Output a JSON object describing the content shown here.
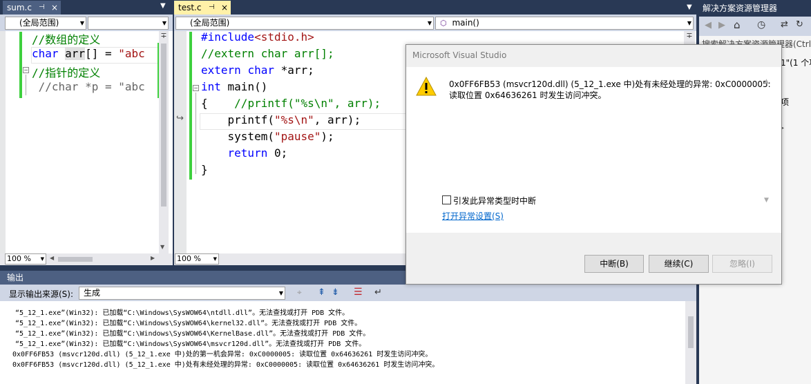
{
  "sum_tab": {
    "name": "sum.c",
    "pin": "⊣",
    "close": "×"
  },
  "test_tab": {
    "name": "test.c",
    "pin": "⊣",
    "close": "×"
  },
  "sum_nav": {
    "scope": "(全局范围)",
    "member": ""
  },
  "test_nav": {
    "scope": "(全局范围)",
    "member": "main()"
  },
  "sum_code": [
    {
      "t": "//数组的定义",
      "c": "cm"
    },
    {
      "parts": [
        [
          "char",
          "kw"
        ],
        [
          " ",
          ""
        ],
        [
          "arr",
          "hl"
        ],
        [
          "[] = ",
          ""
        ],
        [
          "\"abc",
          "st"
        ]
      ]
    },
    {
      "t": "//指针的定义",
      "c": "cm"
    },
    {
      "t": " //char *p = \"abc",
      "c": "gy"
    }
  ],
  "test_code": [
    {
      "parts": [
        [
          "#include",
          "kw"
        ],
        [
          "<stdio.h>",
          "st"
        ]
      ]
    },
    {
      "t": "//extern char arr[];",
      "c": "cm"
    },
    {
      "parts": [
        [
          "extern",
          "kw"
        ],
        [
          " ",
          ""
        ],
        [
          "char",
          "kw"
        ],
        [
          " *arr;",
          ""
        ]
      ]
    },
    {
      "parts": [
        [
          "int",
          "kw"
        ],
        [
          " main()",
          ""
        ]
      ]
    },
    {
      "parts": [
        [
          "{",
          ""
        ],
        [
          "    //printf(\"%s\\n\", arr);",
          "cm"
        ]
      ]
    },
    {
      "parts": [
        [
          "    printf(",
          ""
        ],
        [
          "\"%s\\n\"",
          "st"
        ],
        [
          ", arr);",
          ""
        ]
      ]
    },
    {
      "parts": [
        [
          "    system(",
          ""
        ],
        [
          "\"pause\"",
          "st"
        ],
        [
          ");",
          ""
        ]
      ]
    },
    {
      "parts": [
        [
          "    ",
          ""
        ],
        [
          "return",
          "kw"
        ],
        [
          " 0;",
          ""
        ]
      ]
    },
    {
      "parts": [
        [
          "}",
          ""
        ]
      ]
    }
  ],
  "zoom_left": "100 %",
  "zoom_right": "100 %",
  "solution_explorer": {
    "title": "解决方案资源管理器",
    "search": "搜索解决方案资源管理器(Ctrl",
    "item1": "1\"(1 个项",
    "item2": "项"
  },
  "output": {
    "title": "输出",
    "source_label": "显示输出来源(S):",
    "source_value": "生成",
    "lines": [
      "“5_12_1.exe”(Win32):  已加载“C:\\Windows\\SysWOW64\\ntdll.dll”。无法查找或打开 PDB 文件。",
      "“5_12_1.exe”(Win32):  已加载“C:\\Windows\\SysWOW64\\kernel32.dll”。无法查找或打开 PDB 文件。",
      "“5_12_1.exe”(Win32):  已加载“C:\\Windows\\SysWOW64\\KernelBase.dll”。无法查找或打开 PDB 文件。",
      "“5_12_1.exe”(Win32):  已加载“C:\\Windows\\SysWOW64\\msvcr120d.dll”。无法查找或打开 PDB 文件。",
      "0x0FF6FB53 (msvcr120d.dll) (5_12_1.exe 中)处的第一机会异常:  0xC0000005:  读取位置 0x64636261 时发生访问冲突。",
      "0x0FF6FB53 (msvcr120d.dll) (5_12_1.exe 中)处有未经处理的异常:  0xC0000005:  读取位置 0x64636261 时发生访问冲突。"
    ]
  },
  "dialog": {
    "title": "Microsoft Visual Studio",
    "message1": "0x0FF6FB53 (msvcr120d.dll) (5_12_1.exe 中)处有未经处理的异常:  0xC0000005:",
    "message2": "读取位置 0x64636261 时发生访问冲突。",
    "checkbox": "引发此异常类型时中断",
    "link": "打开异常设置(S)",
    "btn_break": "中断(B)",
    "btn_continue": "继续(C)",
    "btn_ignore": "忽略(I)"
  }
}
